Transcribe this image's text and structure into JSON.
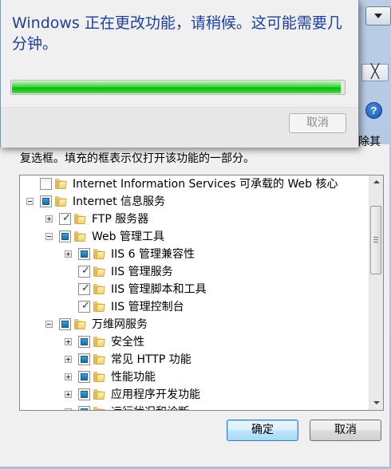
{
  "progress_dialog": {
    "message": "Windows 正在更改功能，请稍候。这可能需要几分钟。",
    "progress": 0.99,
    "cancel_label": "取消"
  },
  "features_dialog": {
    "close_glyph": "╳",
    "help_glyph": "?",
    "description_tail": "除其",
    "description": "复选框。填充的框表示仅打开该功能的一部分。",
    "tree": [
      {
        "label": "Internet Information Services 可承载的 Web 核心",
        "level": 0,
        "expander": "none",
        "state": "unchecked"
      },
      {
        "label": "Internet 信息服务",
        "level": 0,
        "expander": "minus",
        "state": "partial"
      },
      {
        "label": "FTP 服务器",
        "level": 1,
        "expander": "plus",
        "state": "checked"
      },
      {
        "label": "Web 管理工具",
        "level": 1,
        "expander": "minus",
        "state": "partial"
      },
      {
        "label": "IIS 6 管理兼容性",
        "level": 2,
        "expander": "plus",
        "state": "partial"
      },
      {
        "label": "IIS 管理服务",
        "level": 2,
        "expander": "none",
        "state": "checked"
      },
      {
        "label": "IIS 管理脚本和工具",
        "level": 2,
        "expander": "none",
        "state": "checked"
      },
      {
        "label": "IIS 管理控制台",
        "level": 2,
        "expander": "none",
        "state": "checked"
      },
      {
        "label": "万维网服务",
        "level": 1,
        "expander": "minus",
        "state": "partial"
      },
      {
        "label": "安全性",
        "level": 2,
        "expander": "plus",
        "state": "partial"
      },
      {
        "label": "常见 HTTP 功能",
        "level": 2,
        "expander": "plus",
        "state": "partial"
      },
      {
        "label": "性能功能",
        "level": 2,
        "expander": "plus",
        "state": "partial"
      },
      {
        "label": "应用程序开发功能",
        "level": 2,
        "expander": "plus",
        "state": "partial"
      },
      {
        "label": "运行状况和诊断",
        "level": 2,
        "expander": "plus",
        "state": "partial"
      }
    ],
    "ok_label": "确定",
    "cancel_label": "取消"
  }
}
